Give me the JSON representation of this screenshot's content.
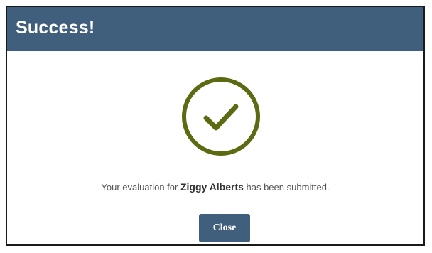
{
  "dialog": {
    "title": "Success!",
    "icon": "checkmark-circle-icon",
    "message": {
      "prefix": "Your evaluation for ",
      "name": "Ziggy Alberts",
      "suffix": " has been submitted."
    },
    "close_label": "Close"
  },
  "colors": {
    "header": "#3f5f7c",
    "check": "#5a6b12",
    "button": "#3f5f7c"
  }
}
